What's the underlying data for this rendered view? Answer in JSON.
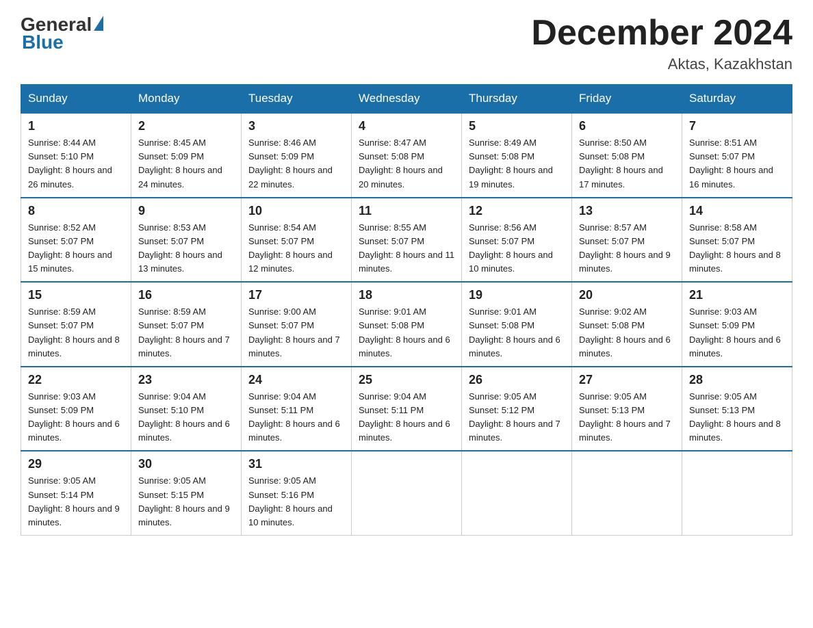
{
  "logo": {
    "general": "General",
    "blue": "Blue"
  },
  "title": "December 2024",
  "location": "Aktas, Kazakhstan",
  "weekdays": [
    "Sunday",
    "Monday",
    "Tuesday",
    "Wednesday",
    "Thursday",
    "Friday",
    "Saturday"
  ],
  "weeks": [
    [
      {
        "day": 1,
        "sunrise": "8:44 AM",
        "sunset": "5:10 PM",
        "daylight": "8 hours and 26 minutes."
      },
      {
        "day": 2,
        "sunrise": "8:45 AM",
        "sunset": "5:09 PM",
        "daylight": "8 hours and 24 minutes."
      },
      {
        "day": 3,
        "sunrise": "8:46 AM",
        "sunset": "5:09 PM",
        "daylight": "8 hours and 22 minutes."
      },
      {
        "day": 4,
        "sunrise": "8:47 AM",
        "sunset": "5:08 PM",
        "daylight": "8 hours and 20 minutes."
      },
      {
        "day": 5,
        "sunrise": "8:49 AM",
        "sunset": "5:08 PM",
        "daylight": "8 hours and 19 minutes."
      },
      {
        "day": 6,
        "sunrise": "8:50 AM",
        "sunset": "5:08 PM",
        "daylight": "8 hours and 17 minutes."
      },
      {
        "day": 7,
        "sunrise": "8:51 AM",
        "sunset": "5:07 PM",
        "daylight": "8 hours and 16 minutes."
      }
    ],
    [
      {
        "day": 8,
        "sunrise": "8:52 AM",
        "sunset": "5:07 PM",
        "daylight": "8 hours and 15 minutes."
      },
      {
        "day": 9,
        "sunrise": "8:53 AM",
        "sunset": "5:07 PM",
        "daylight": "8 hours and 13 minutes."
      },
      {
        "day": 10,
        "sunrise": "8:54 AM",
        "sunset": "5:07 PM",
        "daylight": "8 hours and 12 minutes."
      },
      {
        "day": 11,
        "sunrise": "8:55 AM",
        "sunset": "5:07 PM",
        "daylight": "8 hours and 11 minutes."
      },
      {
        "day": 12,
        "sunrise": "8:56 AM",
        "sunset": "5:07 PM",
        "daylight": "8 hours and 10 minutes."
      },
      {
        "day": 13,
        "sunrise": "8:57 AM",
        "sunset": "5:07 PM",
        "daylight": "8 hours and 9 minutes."
      },
      {
        "day": 14,
        "sunrise": "8:58 AM",
        "sunset": "5:07 PM",
        "daylight": "8 hours and 8 minutes."
      }
    ],
    [
      {
        "day": 15,
        "sunrise": "8:59 AM",
        "sunset": "5:07 PM",
        "daylight": "8 hours and 8 minutes."
      },
      {
        "day": 16,
        "sunrise": "8:59 AM",
        "sunset": "5:07 PM",
        "daylight": "8 hours and 7 minutes."
      },
      {
        "day": 17,
        "sunrise": "9:00 AM",
        "sunset": "5:07 PM",
        "daylight": "8 hours and 7 minutes."
      },
      {
        "day": 18,
        "sunrise": "9:01 AM",
        "sunset": "5:08 PM",
        "daylight": "8 hours and 6 minutes."
      },
      {
        "day": 19,
        "sunrise": "9:01 AM",
        "sunset": "5:08 PM",
        "daylight": "8 hours and 6 minutes."
      },
      {
        "day": 20,
        "sunrise": "9:02 AM",
        "sunset": "5:08 PM",
        "daylight": "8 hours and 6 minutes."
      },
      {
        "day": 21,
        "sunrise": "9:03 AM",
        "sunset": "5:09 PM",
        "daylight": "8 hours and 6 minutes."
      }
    ],
    [
      {
        "day": 22,
        "sunrise": "9:03 AM",
        "sunset": "5:09 PM",
        "daylight": "8 hours and 6 minutes."
      },
      {
        "day": 23,
        "sunrise": "9:04 AM",
        "sunset": "5:10 PM",
        "daylight": "8 hours and 6 minutes."
      },
      {
        "day": 24,
        "sunrise": "9:04 AM",
        "sunset": "5:11 PM",
        "daylight": "8 hours and 6 minutes."
      },
      {
        "day": 25,
        "sunrise": "9:04 AM",
        "sunset": "5:11 PM",
        "daylight": "8 hours and 6 minutes."
      },
      {
        "day": 26,
        "sunrise": "9:05 AM",
        "sunset": "5:12 PM",
        "daylight": "8 hours and 7 minutes."
      },
      {
        "day": 27,
        "sunrise": "9:05 AM",
        "sunset": "5:13 PM",
        "daylight": "8 hours and 7 minutes."
      },
      {
        "day": 28,
        "sunrise": "9:05 AM",
        "sunset": "5:13 PM",
        "daylight": "8 hours and 8 minutes."
      }
    ],
    [
      {
        "day": 29,
        "sunrise": "9:05 AM",
        "sunset": "5:14 PM",
        "daylight": "8 hours and 9 minutes."
      },
      {
        "day": 30,
        "sunrise": "9:05 AM",
        "sunset": "5:15 PM",
        "daylight": "8 hours and 9 minutes."
      },
      {
        "day": 31,
        "sunrise": "9:05 AM",
        "sunset": "5:16 PM",
        "daylight": "8 hours and 10 minutes."
      },
      null,
      null,
      null,
      null
    ]
  ]
}
